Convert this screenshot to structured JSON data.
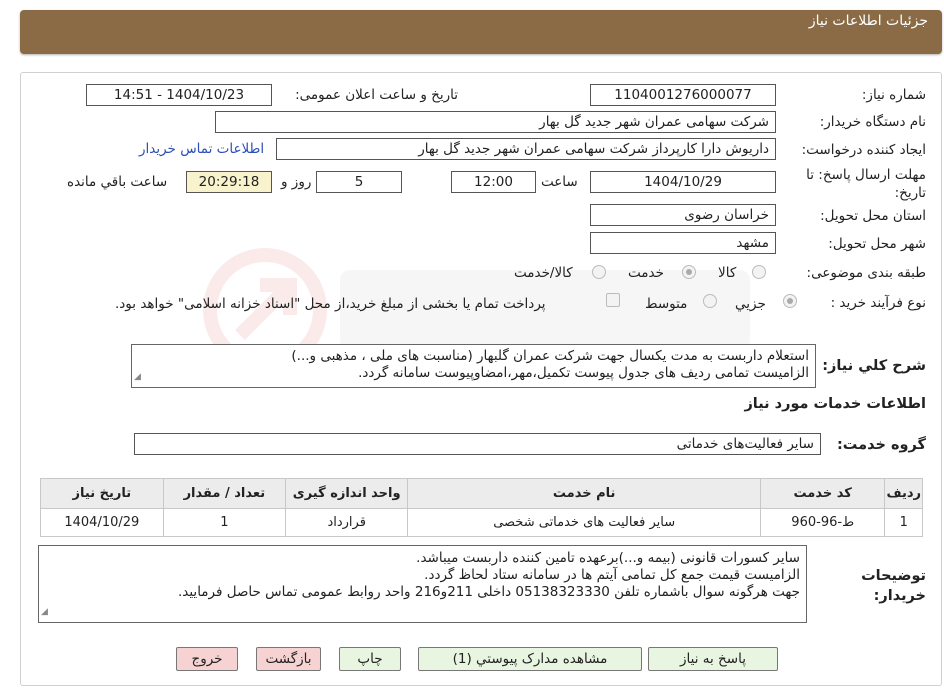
{
  "header": {
    "title": "جزئیات اطلاعات نیاز"
  },
  "fields": {
    "need_number_label": "شماره نیاز:",
    "need_number": "1104001276000077",
    "announce_label": "تاریخ و ساعت اعلان عمومی:",
    "announce_value": "1404/10/23 - 14:51",
    "buyer_org_label": "نام دستگاه خریدار:",
    "buyer_org": "شرکت سهامی عمران شهر جدید گل بهار",
    "requester_label": "ایجاد کننده درخواست:",
    "requester": "داریوش دارا کارپرداز شرکت سهامی عمران شهر جدید گل بهار",
    "buyer_contact_link": "اطلاعات تماس خریدار",
    "deadline_label": "مهلت ارسال پاسخ: تا تاریخ:",
    "deadline_date": "1404/10/29",
    "time_label": "ساعت",
    "deadline_time": "12:00",
    "days_value": "5",
    "days_label": "روز و",
    "remaining_time": "20:29:18",
    "remaining_label": "ساعت باقي مانده",
    "province_label": "استان محل تحویل:",
    "province": "خراسان رضوی",
    "city_label": "شهر محل تحویل:",
    "city": "مشهد",
    "category_label": "طبقه بندی موضوعی:",
    "category_options": [
      "کالا",
      "خدمت",
      "کالا/خدمت"
    ],
    "process_label": "نوع فرآیند خرید :",
    "process_options": [
      "جزيي",
      "متوسط"
    ],
    "payment_note": "پرداخت تمام یا بخشی از مبلغ خرید،از محل \"اسناد خزانه اسلامی\" خواهد بود."
  },
  "summary": {
    "label": "شرح كلي نياز:",
    "lines": [
      "استعلام داربست به مدت یکسال جهت شرکت عمران گلبهار (مناسبت های ملی ، مذهبی و...)",
      "الزامیست تمامی ردیف های جدول پیوست تکمیل،مهر،امضاوپیوست سامانه گردد."
    ]
  },
  "services_section": {
    "title": "اطلاعات خدمات مورد نياز",
    "group_label": "گروه خدمت:",
    "group_value": "سایر فعالیت‌های خدماتی",
    "columns": [
      "رديف",
      "کد خدمت",
      "نام خدمت",
      "واحد اندازه گیری",
      "تعداد / مقدار",
      "تاریخ نیاز"
    ],
    "rows": [
      [
        "1",
        "ط-96-960",
        "سایر فعالیت های خدماتی شخصی",
        "قرارداد",
        "1",
        "1404/10/29"
      ]
    ]
  },
  "buyer_notes": {
    "label": "توضيحات خريدار:",
    "lines": [
      "سایر کسورات قانونی (بیمه و...)برعهده تامین کننده داربست میباشد.",
      "الزامیست قیمت جمع کل تمامی آیتم ها در سامانه ستاد لحاظ گردد.",
      "جهت هرگونه سوال باشماره تلفن  05138323330 داخلی 211و216  واحد روابط عمومی تماس حاصل فرمایید."
    ]
  },
  "buttons": {
    "reply": "پاسخ به نیاز",
    "attachments": "مشاهده مدارک پیوستي (1)",
    "print": "چاپ",
    "back": "بازگشت",
    "exit": "خروج"
  },
  "colors": {
    "header": "#8a6b45",
    "button_green": "#e8f5e1",
    "button_red": "#f7d2d2"
  }
}
